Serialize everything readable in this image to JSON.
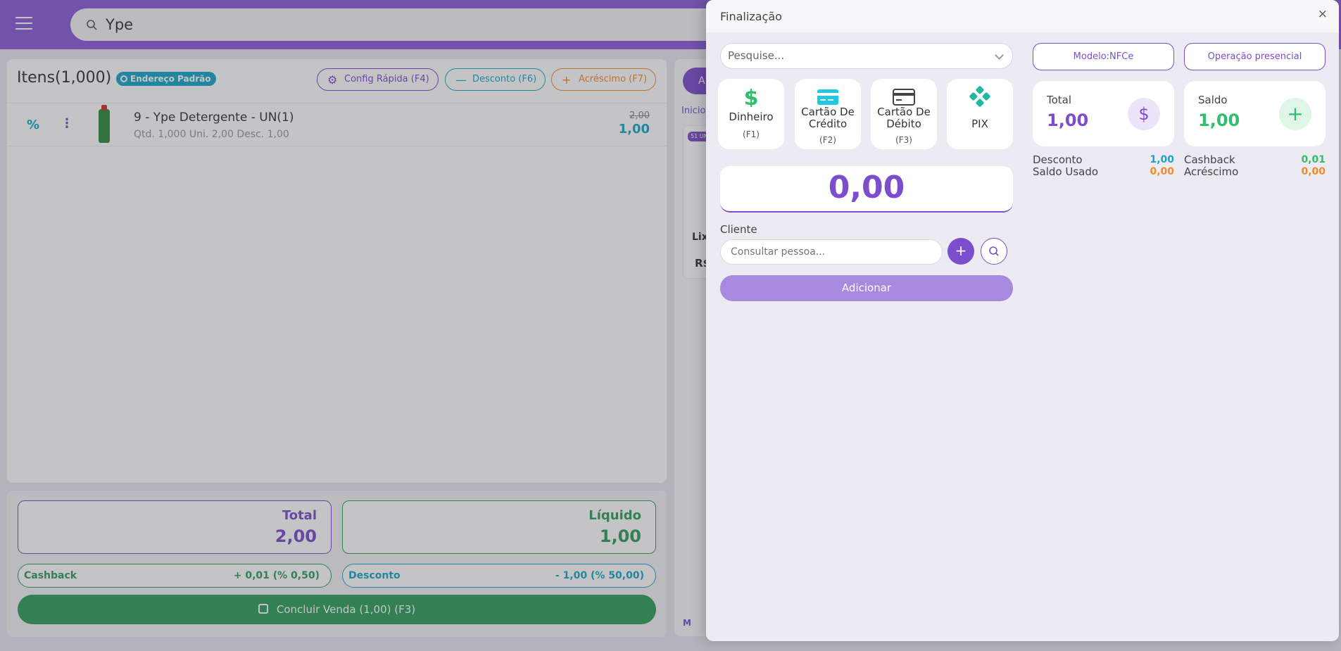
{
  "background": {
    "search_text": "Ype",
    "items_title": "Itens(1,000)",
    "address_badge": "Endereço Padrão",
    "config_btn": "Config Rápida (F4)",
    "desc_btn": "Desconto (F6)",
    "acres_btn": "Acréscimo (F7)",
    "item": {
      "name": "9 - Ype Detergente - UN(1)",
      "sub": "Qtd. 1,000  Uni. 2,00  Desc. 1,00",
      "old_price": "2,00",
      "new_price": "1,00"
    },
    "right": {
      "pill": "A",
      "inicio": "Inicio",
      "tag": "51 UN",
      "lix": "Lix",
      "rs": "R$",
      "m": "M"
    },
    "total_label": "Total",
    "total_value": "2,00",
    "liquido_label": "Líquido",
    "liquido_value": "1,00",
    "cashback_label": "Cashback",
    "cashback_value": "+ 0,01 (% 0,50)",
    "desconto_label": "Desconto",
    "desconto_value": "- 1,00 (% 50,00)",
    "concluir": "Concluir Venda (1,00) (F3)"
  },
  "modal": {
    "title": "Finalização",
    "close": "×",
    "select_placeholder": "Pesquise...",
    "methods": [
      {
        "label": "Dinheiro",
        "key": "(F1)"
      },
      {
        "label": "Cartão De Crédito",
        "key": "(F2)"
      },
      {
        "label": "Cartão De Débito",
        "key": "(F3)"
      },
      {
        "label": "PIX",
        "key": ""
      }
    ],
    "amount": "0,00",
    "cliente_label": "Cliente",
    "cliente_placeholder": "Consultar pessoa...",
    "add_symbol": "+",
    "adicionar": "Adicionar",
    "modelo": "Modelo:NFCe",
    "operacao": "Operação presencial",
    "total_label": "Total",
    "total_value": "1,00",
    "total_icon": "$",
    "saldo_label": "Saldo",
    "saldo_value": "1,00",
    "saldo_icon": "+",
    "desconto_label": "Desconto",
    "desconto_value": "1,00",
    "saldo_usado_label": "Saldo Usado",
    "saldo_usado_value": "0,00",
    "cashback_label": "Cashback",
    "cashback_value": "0,01",
    "acrescimo_label": "Acréscimo",
    "acrescimo_value": "0,00"
  },
  "colors": {
    "primary": "#7c4dcc",
    "green": "#2fbf6e",
    "cyan": "#17a6c8",
    "orange": "#f08c2c"
  }
}
